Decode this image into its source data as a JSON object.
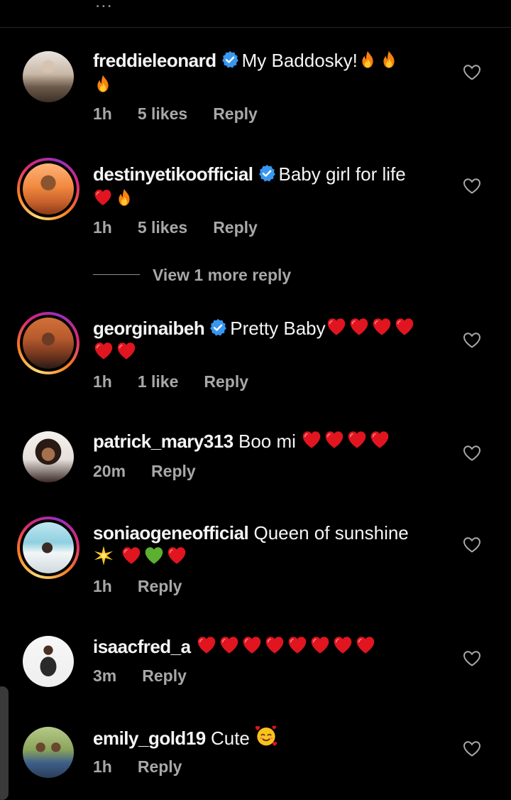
{
  "header": {
    "ellipsis": "..."
  },
  "comments": [
    {
      "username": "freddieleonard",
      "verified": true,
      "text": "My Baddosky!",
      "emojis_line1": [
        "fire",
        "fire"
      ],
      "emojis_line2": [
        "fire"
      ],
      "time": "1h",
      "likes": "5 likes",
      "reply": "Reply",
      "avatar_style": "plain",
      "avatar_icon": "avatar-photo"
    },
    {
      "username": "destinyetikoofficial",
      "verified": true,
      "text": "Baby girl for life",
      "emojis_line2": [
        "red-heart",
        "fire"
      ],
      "time": "1h",
      "likes": "5 likes",
      "reply": "Reply",
      "avatar_style": "story",
      "avatar_icon": "avatar-photo"
    },
    {
      "username": "georginaibeh",
      "verified": true,
      "text": "Pretty Baby",
      "emojis_line1": [
        "red-heart",
        "red-heart",
        "red-heart",
        "red-heart"
      ],
      "emojis_line2": [
        "red-heart",
        "red-heart"
      ],
      "time": "1h",
      "likes": "1 like",
      "reply": "Reply",
      "avatar_style": "story",
      "avatar_icon": "avatar-photo"
    },
    {
      "username": "patrick_mary313",
      "verified": false,
      "text": "Boo mi",
      "emojis_line1": [
        "red-heart",
        "red-heart",
        "red-heart",
        "red-heart"
      ],
      "time": "20m",
      "reply": "Reply",
      "avatar_style": "plain",
      "avatar_icon": "avatar-photo"
    },
    {
      "username": "soniaogeneofficial",
      "verified": false,
      "text": "Queen of sunshine",
      "emojis_line2": [
        "sparkle",
        "red-heart",
        "green-heart",
        "red-heart"
      ],
      "time": "1h",
      "reply": "Reply",
      "avatar_style": "story",
      "avatar_icon": "avatar-photo"
    },
    {
      "username": "isaacfred_a",
      "verified": false,
      "text": "",
      "emojis_line1": [
        "red-heart",
        "red-heart",
        "red-heart",
        "red-heart",
        "red-heart",
        "red-heart",
        "red-heart",
        "red-heart"
      ],
      "time": "3m",
      "reply": "Reply",
      "avatar_style": "plain",
      "avatar_icon": "avatar-photo"
    },
    {
      "username": "emily_gold19",
      "verified": false,
      "text": "Cute",
      "emojis_line1": [
        "smiling-face-with-hearts"
      ],
      "time": "1h",
      "reply": "Reply",
      "avatar_style": "plain",
      "avatar_icon": "avatar-photo"
    }
  ],
  "view_more_reply": "View 1 more reply",
  "icons": {
    "like": "heart-outline-icon",
    "verified": "verified-badge-icon"
  },
  "colors": {
    "background": "#000000",
    "text": "#f5f5f5",
    "secondary": "#a8a8a8",
    "verified": "#3897f0",
    "heart": "#e0151f"
  }
}
